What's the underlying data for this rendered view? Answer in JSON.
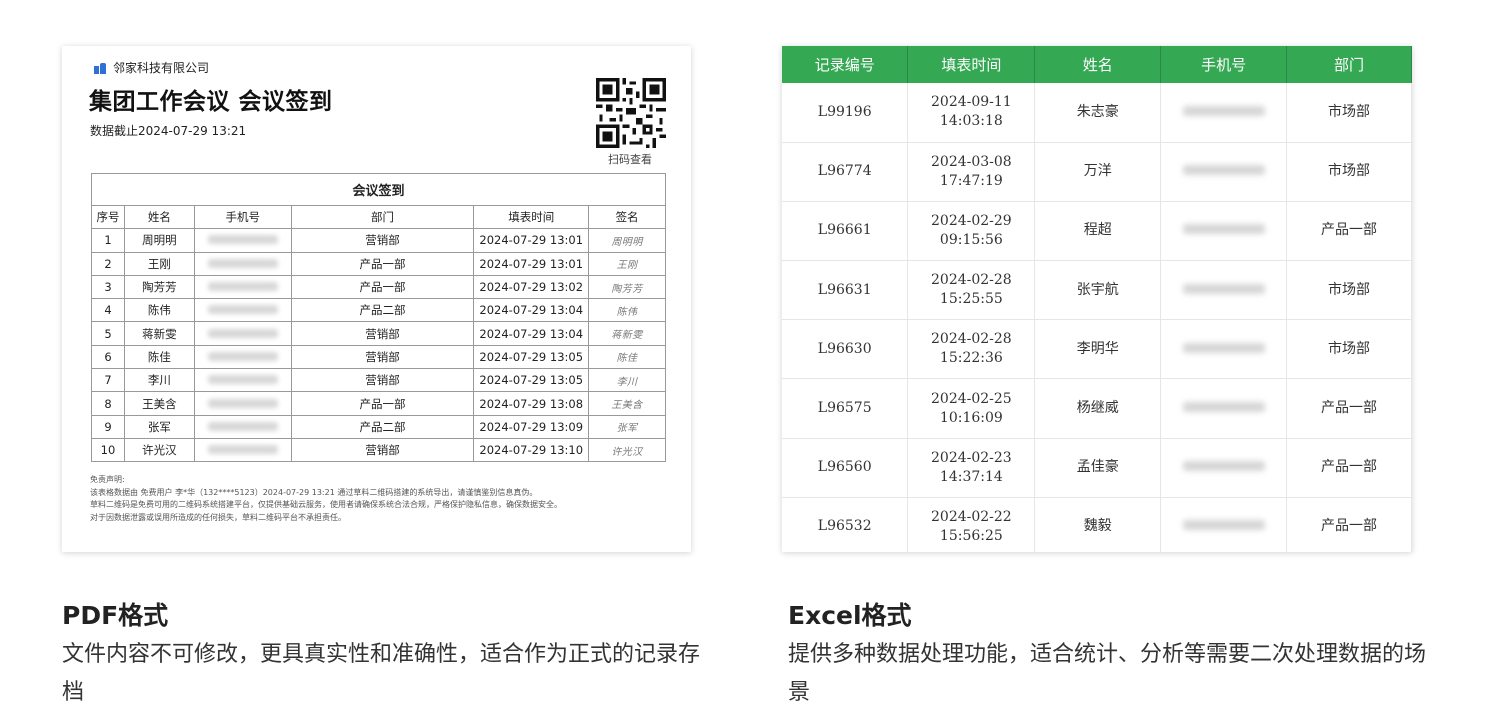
{
  "pdf": {
    "company": "邻家科技有限公司",
    "title": "集团工作会议 会议签到",
    "deadline": "数据截止2024-07-29 13:21",
    "qr_label": "扫码查看",
    "table_caption": "会议签到",
    "columns": [
      "序号",
      "姓名",
      "手机号",
      "部门",
      "填表时间",
      "签名"
    ],
    "rows": [
      {
        "no": "1",
        "name": "周明明",
        "dept": "营销部",
        "time": "2024-07-29 13:01",
        "sig": "周明明"
      },
      {
        "no": "2",
        "name": "王刚",
        "dept": "产品一部",
        "time": "2024-07-29 13:01",
        "sig": "王刚"
      },
      {
        "no": "3",
        "name": "陶芳芳",
        "dept": "产品一部",
        "time": "2024-07-29 13:02",
        "sig": "陶芳芳"
      },
      {
        "no": "4",
        "name": "陈伟",
        "dept": "产品二部",
        "time": "2024-07-29 13:04",
        "sig": "陈伟"
      },
      {
        "no": "5",
        "name": "蒋新雯",
        "dept": "营销部",
        "time": "2024-07-29 13:04",
        "sig": "蒋新雯"
      },
      {
        "no": "6",
        "name": "陈佳",
        "dept": "营销部",
        "time": "2024-07-29 13:05",
        "sig": "陈佳"
      },
      {
        "no": "7",
        "name": "李川",
        "dept": "营销部",
        "time": "2024-07-29 13:05",
        "sig": "李川"
      },
      {
        "no": "8",
        "name": "王美含",
        "dept": "产品一部",
        "time": "2024-07-29 13:08",
        "sig": "王美含"
      },
      {
        "no": "9",
        "name": "张军",
        "dept": "产品二部",
        "time": "2024-07-29 13:09",
        "sig": "张军"
      },
      {
        "no": "10",
        "name": "许光汉",
        "dept": "营销部",
        "time": "2024-07-29 13:10",
        "sig": "许光汉"
      }
    ],
    "disclaimer": [
      "免责声明:",
      "该表格数据由 免费用户 李*华（132****5123）2024-07-29 13:21 通过草料二维码搭建的系统导出，请谨慎鉴别信息真伪。",
      "草料二维码是免费可用的二维码系统搭建平台，仅提供基础云服务，使用者请确保系统合法合规，严格保护隐私信息，确保数据安全。",
      "对于因数据泄露或误用所造成的任何损失，草料二维码平台不承担责任。"
    ]
  },
  "excel": {
    "columns": [
      "记录编号",
      "填表时间",
      "姓名",
      "手机号",
      "部门"
    ],
    "header_color": "#34a853",
    "rows": [
      {
        "id": "L99196",
        "date": "2024-09-11",
        "time": "14:03:18",
        "name": "朱志豪",
        "dept": "市场部"
      },
      {
        "id": "L96774",
        "date": "2024-03-08",
        "time": "17:47:19",
        "name": "万洋",
        "dept": "市场部"
      },
      {
        "id": "L96661",
        "date": "2024-02-29",
        "time": "09:15:56",
        "name": "程超",
        "dept": "产品一部"
      },
      {
        "id": "L96631",
        "date": "2024-02-28",
        "time": "15:25:55",
        "name": "张宇航",
        "dept": "市场部"
      },
      {
        "id": "L96630",
        "date": "2024-02-28",
        "time": "15:22:36",
        "name": "李明华",
        "dept": "市场部"
      },
      {
        "id": "L96575",
        "date": "2024-02-25",
        "time": "10:16:09",
        "name": "杨继威",
        "dept": "产品一部"
      },
      {
        "id": "L96560",
        "date": "2024-02-23",
        "time": "14:37:14",
        "name": "孟佳豪",
        "dept": "产品一部"
      },
      {
        "id": "L96532",
        "date": "2024-02-22",
        "time": "15:56:25",
        "name": "魏毅",
        "dept": "产品一部"
      }
    ]
  },
  "captions": {
    "pdf_title": "PDF格式",
    "pdf_desc": "文件内容不可修改，更具真实性和准确性，适合作为正式的记录存档",
    "excel_title": "Excel格式",
    "excel_desc": "提供多种数据处理功能，适合统计、分析等需要二次处理数据的场景"
  }
}
